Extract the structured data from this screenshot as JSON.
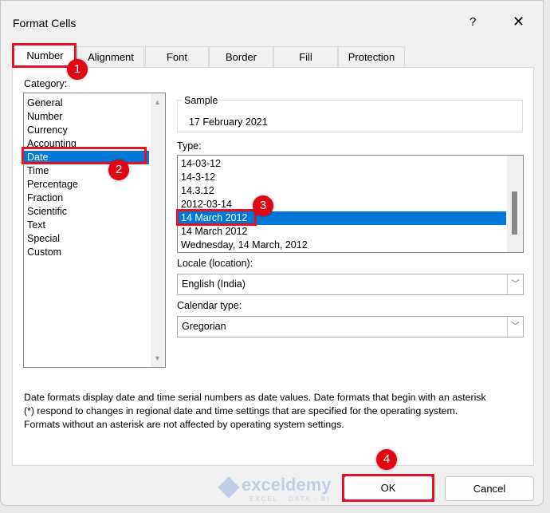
{
  "window": {
    "title": "Format Cells",
    "help": "?",
    "close": "✕"
  },
  "tabs": [
    "Number",
    "Alignment",
    "Font",
    "Border",
    "Fill",
    "Protection"
  ],
  "category": {
    "label": "Category:",
    "items": [
      "General",
      "Number",
      "Currency",
      "Accounting",
      "Date",
      "Time",
      "Percentage",
      "Fraction",
      "Scientific",
      "Text",
      "Special",
      "Custom"
    ],
    "selected": "Date"
  },
  "sample": {
    "label": "Sample",
    "value": "17 February 2021"
  },
  "type": {
    "label": "Type:",
    "items": [
      "14-03-12",
      "14-3-12",
      "14.3.12",
      "2012-03-14",
      "14 March 2012",
      "14 March 2012",
      "Wednesday, 14 March, 2012"
    ],
    "selected_index": 4
  },
  "locale": {
    "label": "Locale (location):",
    "value": "English (India)"
  },
  "calendar": {
    "label": "Calendar type:",
    "value": "Gregorian"
  },
  "description": [
    "Date formats display date and time serial numbers as date values.  Date formats that begin with an asterisk",
    "(*) respond to changes in regional date and time settings that are specified for the operating system.",
    "Formats without an asterisk are not affected by operating system settings."
  ],
  "buttons": {
    "ok": "OK",
    "cancel": "Cancel"
  },
  "badges": [
    "1",
    "2",
    "3",
    "4"
  ],
  "watermark": {
    "name": "exceldemy",
    "tagline": "EXCEL - DATA - BI"
  },
  "colors": {
    "selection": "#0078d7",
    "annotation": "#e30613"
  }
}
